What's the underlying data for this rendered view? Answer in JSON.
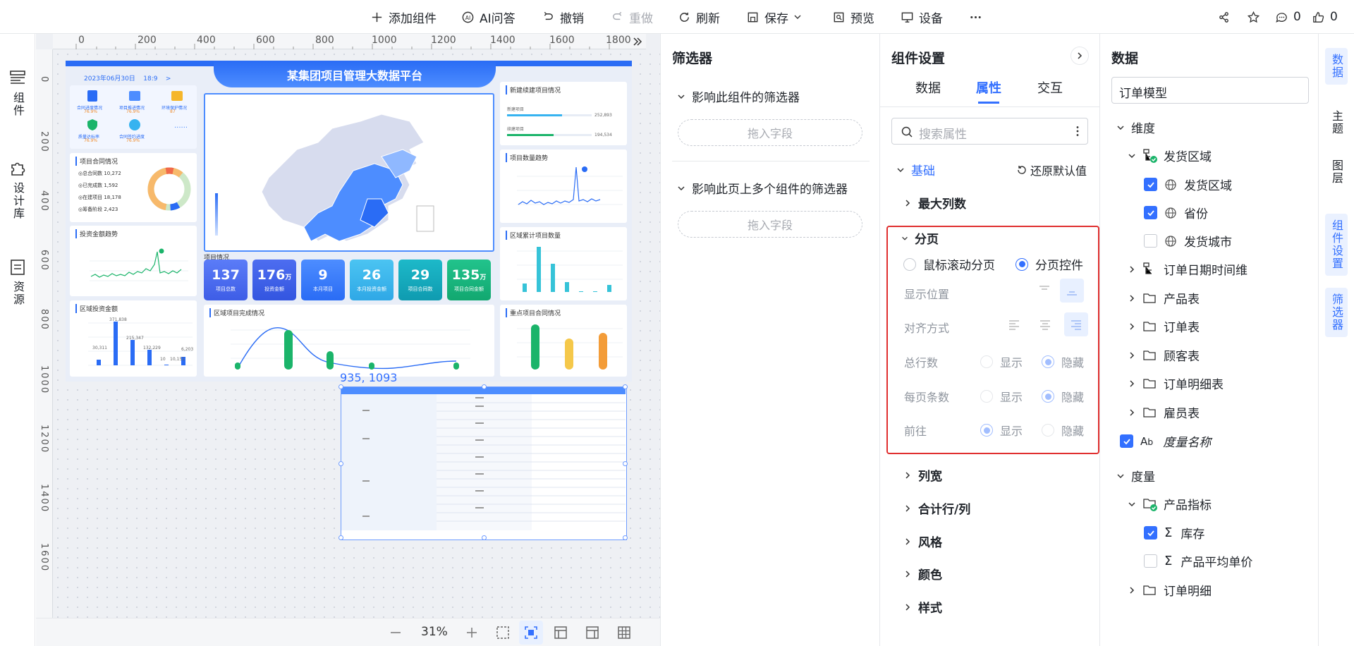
{
  "toolbar": {
    "add_component": "添加组件",
    "ai_qa": "AI问答",
    "undo": "撤销",
    "redo": "重做",
    "refresh": "刷新",
    "save": "保存",
    "preview": "预览",
    "device": "设备",
    "comment_count": "0",
    "like_count": "0"
  },
  "left_rail": {
    "components": "组件",
    "design_library": "设计库",
    "resources": "资源"
  },
  "canvas": {
    "ruler_h": [
      "0",
      "200",
      "400",
      "600",
      "800",
      "1000",
      "1200",
      "1400",
      "1600",
      "1800"
    ],
    "ruler_v": [
      "0",
      "200",
      "400",
      "600",
      "800",
      "1000",
      "1200",
      "1400",
      "1600"
    ],
    "coord_label": "935, 1093",
    "zoom": "31%"
  },
  "dashboard": {
    "title": "某集团项目管理大数据平台",
    "date": "2023年06月30日",
    "time": "18:9",
    "status_items": [
      {
        "label": "合同进度情况",
        "value": "76.9%"
      },
      {
        "label": "项目推进情况",
        "value": "76.9%"
      },
      {
        "label": "环境保护情况",
        "value": "87"
      },
      {
        "label": "质量达标率",
        "value": "76.9%"
      },
      {
        "label": "合同签约进度",
        "value": "76.9%"
      }
    ],
    "contract": {
      "title": "项目合同情况",
      "items": [
        {
          "label": "总合同数",
          "value": "10,272"
        },
        {
          "label": "已完成数",
          "value": "1,592"
        },
        {
          "label": "在建项目",
          "value": "18,178"
        },
        {
          "label": "筹备阶段",
          "value": "2,423"
        }
      ]
    },
    "invest_trend_title": "投资金额趋势",
    "region_invest_title": "区域投资金额",
    "region_invest_values": [
      "30,311",
      "371,838",
      "215,347",
      "132,229",
      "10",
      "10,151",
      "6,203"
    ],
    "new_projects_title": "新建续建项目情况",
    "new_label": "新建项目",
    "new_value": "252,893",
    "continue_label": "续建项目",
    "continue_value": "194,534",
    "project_trend_title": "项目数量趋势",
    "region_count_title": "区域累计项目数量",
    "key_contract_title": "重点项目合同情况",
    "completion_title": "区域项目完成情况",
    "overview_title": "项目情况",
    "kpis": [
      {
        "value": "137",
        "unit": "",
        "label": "项目总数"
      },
      {
        "value": "176",
        "unit": "万",
        "label": "投资金额"
      },
      {
        "value": "9",
        "unit": "",
        "label": "本月项目"
      },
      {
        "value": "26",
        "unit": "",
        "label": "本月投资金额"
      },
      {
        "value": "29",
        "unit": "",
        "label": "项目合同数"
      },
      {
        "value": "135",
        "unit": "万",
        "label": "项目合同金额"
      }
    ]
  },
  "filter_panel": {
    "title": "筛选器",
    "section1": "影响此组件的筛选器",
    "section2": "影响此页上多个组件的筛选器",
    "drop_field": "拖入字段"
  },
  "settings_panel": {
    "title": "组件设置",
    "tabs": [
      "数据",
      "属性",
      "交互"
    ],
    "active_tab": "属性",
    "search_placeholder": "搜索属性",
    "basic": "基础",
    "reset": "还原默认值",
    "max_columns": "最大列数",
    "pagination": "分页",
    "scroll_paging": "鼠标滚动分页",
    "paging_control": "分页控件",
    "display_position": "显示位置",
    "alignment": "对齐方式",
    "total_rows": "总行数",
    "per_page": "每页条数",
    "goto": "前往",
    "show": "显示",
    "hide": "隐藏",
    "column_width": "列宽",
    "total_row_col": "合计行/列",
    "style_theme": "风格",
    "color": "颜色",
    "style": "样式",
    "highlight_color": "#e02f2f"
  },
  "data_panel": {
    "title": "数据",
    "model": "订单模型",
    "dimension": "维度",
    "ship_region_group": "发货区域",
    "ship_region": "发货区域",
    "province": "省份",
    "ship_city": "发货城市",
    "order_date": "订单日期时间维",
    "product_table": "产品表",
    "order_table": "订单表",
    "customer_table": "顾客表",
    "order_detail_table": "订单明细表",
    "employee_table": "雇员表",
    "measure_name": "度量名称",
    "measure": "度量",
    "product_metric": "产品指标",
    "stock": "库存",
    "avg_price": "产品平均单价",
    "order_detail": "订单明细"
  },
  "right_rail": {
    "data": "数据",
    "theme": "主题",
    "layers": "图层",
    "component_settings": "组件设置",
    "filter": "筛选器"
  },
  "colors": {
    "accent": "#3370ff",
    "dashboard_blue": "#2a6cf5"
  }
}
